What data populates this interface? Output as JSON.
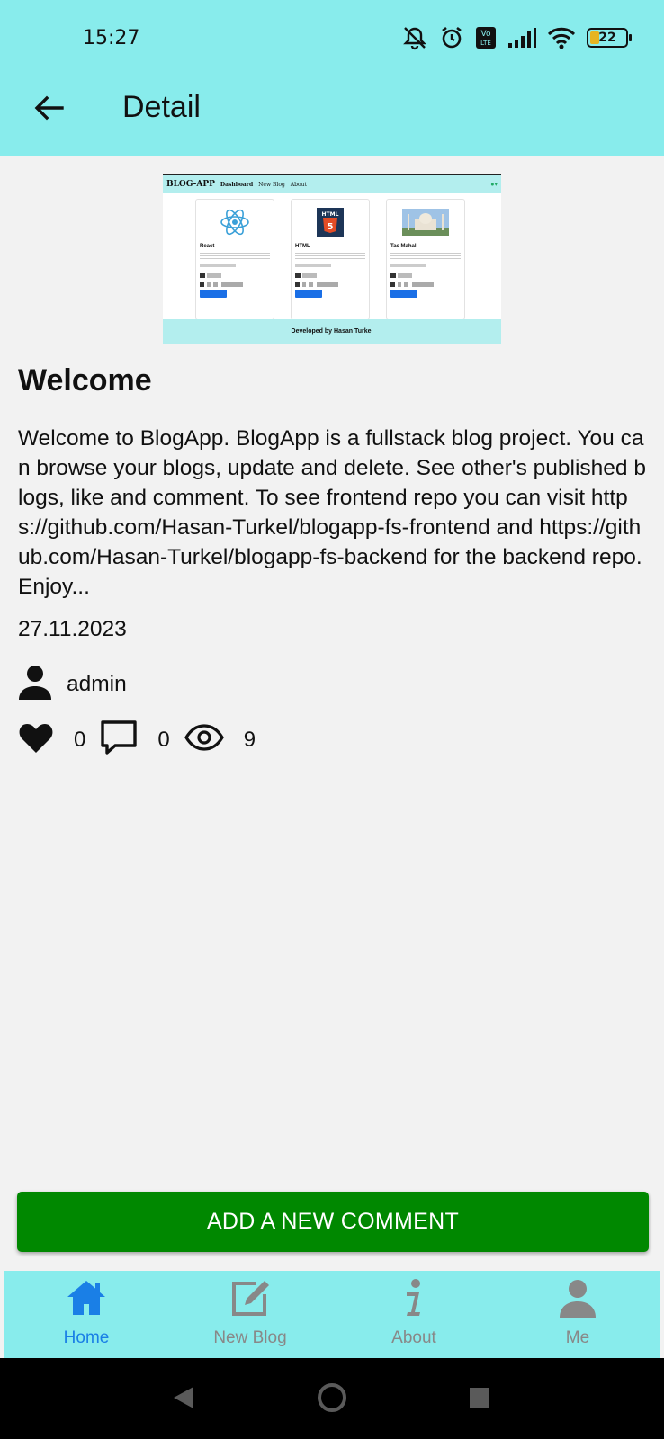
{
  "status_bar": {
    "time": "15:27",
    "battery": "22",
    "network_label": "Vo LTE"
  },
  "app_bar": {
    "title": "Detail"
  },
  "preview": {
    "brand": "BLOG-APP",
    "nav_links": [
      "Dashboard",
      "New Blog",
      "About"
    ],
    "cards": [
      {
        "title": "React"
      },
      {
        "title": "HTML"
      },
      {
        "title": "Tac Mahal"
      }
    ],
    "footer": "Developed by Hasan Turkel"
  },
  "post": {
    "title": "Welcome",
    "content": "Welcome to BlogApp. BlogApp is a fullstack blog project. You can browse your blogs, update and delete. See other's published blogs, like and comment. To see frontend repo you can visit https://github.com/Hasan-Turkel/blogapp-fs-frontend and https://github.com/Hasan-Turkel/blogapp-fs-backend for the backend repo. Enjoy...",
    "date": "27.11.2023",
    "author": "admin",
    "likes": "0",
    "comments": "0",
    "views": "9"
  },
  "actions": {
    "add_comment_label": "ADD A NEW COMMENT"
  },
  "bottom_nav": {
    "items": [
      {
        "label": "Home",
        "icon": "home-icon",
        "active": true
      },
      {
        "label": "New Blog",
        "icon": "edit-icon",
        "active": false
      },
      {
        "label": "About",
        "icon": "info-icon",
        "active": false
      },
      {
        "label": "Me",
        "icon": "person-icon",
        "active": false
      }
    ]
  },
  "colors": {
    "header": "#88ecec",
    "accent": "#1a7fe6",
    "button": "#008800",
    "background": "#f2f2f2"
  }
}
